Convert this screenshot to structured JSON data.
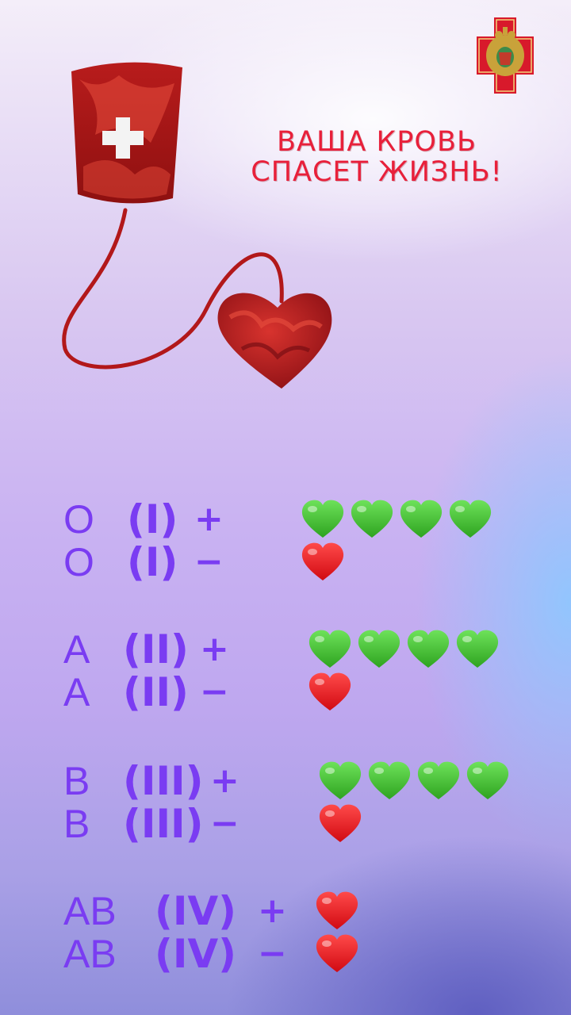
{
  "headline": {
    "line1": "ВАША КРОВЬ",
    "line2": "СПАСЕТ ЖИЗНЬ!"
  },
  "colors": {
    "accent_red": "#e8203a",
    "text_purple": "#7a3cf2",
    "heart_green": "#3bbf2a",
    "heart_red": "#e3101b"
  },
  "blood_groups": [
    {
      "rows": [
        {
          "type": "O",
          "roman": "(I)",
          "rh": "+",
          "hearts": [
            "green",
            "green",
            "green",
            "green"
          ]
        },
        {
          "type": "O",
          "roman": "(I)",
          "rh": "−",
          "hearts": [
            "red"
          ]
        }
      ]
    },
    {
      "rows": [
        {
          "type": "A",
          "roman": "(II)",
          "rh": "+",
          "hearts": [
            "green",
            "green",
            "green",
            "green"
          ]
        },
        {
          "type": "A",
          "roman": "(II)",
          "rh": "−",
          "hearts": [
            "red"
          ]
        }
      ]
    },
    {
      "rows": [
        {
          "type": "B",
          "roman": "(III)",
          "rh": "+",
          "hearts": [
            "green",
            "green",
            "green",
            "green"
          ]
        },
        {
          "type": "B",
          "roman": "(III)",
          "rh": "−",
          "hearts": [
            "red"
          ]
        }
      ]
    },
    {
      "rows": [
        {
          "type": "AB",
          "roman": "(IV)",
          "rh": "+",
          "hearts": [
            "red"
          ]
        },
        {
          "type": "AB",
          "roman": "(IV)",
          "rh": "−",
          "hearts": [
            "red"
          ]
        }
      ]
    }
  ]
}
